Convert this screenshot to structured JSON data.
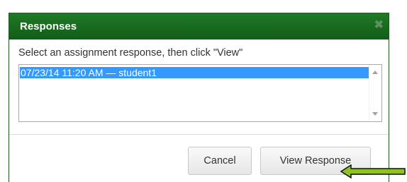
{
  "dialog": {
    "title": "Responses",
    "close_icon": "close-icon",
    "instruction": "Select an assignment response, then click \"View\"",
    "responses": [
      "07/23/14 11:20 AM — student1"
    ],
    "selected_index": 0
  },
  "buttons": {
    "cancel_label": "Cancel",
    "view_label": "View Response"
  },
  "annotation": {
    "arrow_color": "#8fc31f",
    "arrow_icon": "arrow-left-icon"
  },
  "colors": {
    "titlebar": "#16651c",
    "selection": "#3399ff"
  }
}
